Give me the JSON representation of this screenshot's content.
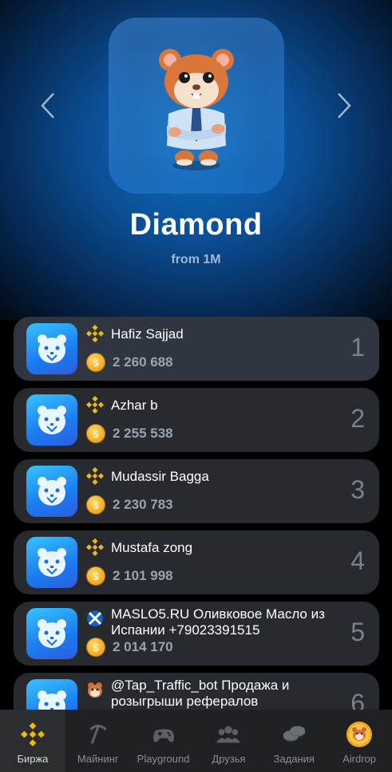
{
  "league": {
    "title": "Diamond",
    "subtitle": "from 1M"
  },
  "leaderboard": [
    {
      "name": "Hafiz Sajjad",
      "score": "2 260 688",
      "rank": "1",
      "badge": "binance"
    },
    {
      "name": "Azhar b",
      "score": "2 255 538",
      "rank": "2",
      "badge": "binance"
    },
    {
      "name": "Mudassir Bagga",
      "score": "2 230 783",
      "rank": "3",
      "badge": "binance"
    },
    {
      "name": "Mustafa zong",
      "score": "2 101 998",
      "rank": "4",
      "badge": "binance"
    },
    {
      "name": "MASLO5.RU Оливковое Масло из Испании +79023391515",
      "score": "2 014 170",
      "rank": "5",
      "badge": "scotland-flag"
    },
    {
      "name": "@Tap_Traffic_bot Продажа и розыгрыши рефералов",
      "score": "",
      "rank": "6",
      "badge": "hamster"
    }
  ],
  "nav": [
    {
      "label": "Биржа",
      "icon": "binance-icon",
      "active": true
    },
    {
      "label": "Майнинг",
      "icon": "pickaxe-icon"
    },
    {
      "label": "Playground",
      "icon": "gamepad-icon"
    },
    {
      "label": "Друзья",
      "icon": "friends-icon"
    },
    {
      "label": "Задания",
      "icon": "coins-icon"
    },
    {
      "label": "Airdrop",
      "icon": "hamster-coin-icon"
    }
  ],
  "colors": {
    "accent": "#f0b90b",
    "card": "#272a2f",
    "nav_bg": "#1f2124"
  }
}
